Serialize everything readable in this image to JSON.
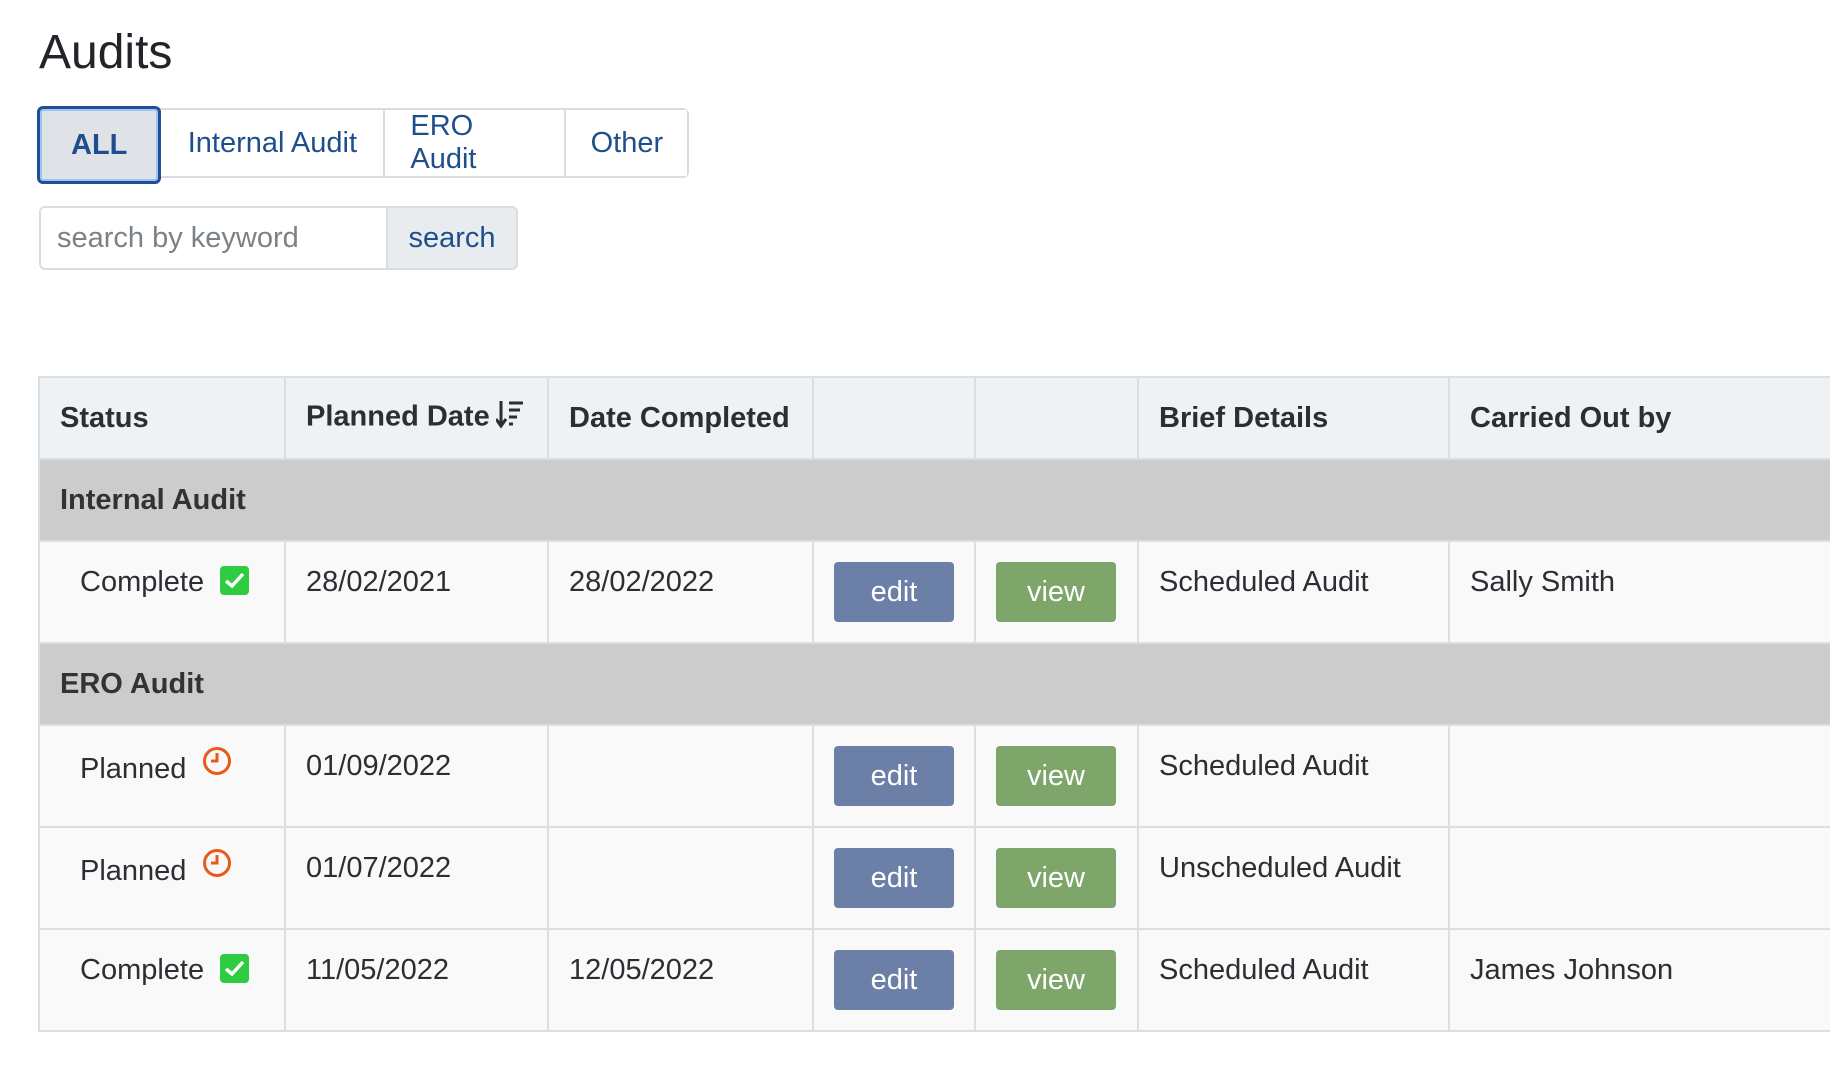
{
  "page": {
    "title": "Audits"
  },
  "filters": {
    "all": "ALL",
    "internal": "Internal Audit",
    "ero": "ERO Audit",
    "other": "Other"
  },
  "search": {
    "placeholder": "search by keyword",
    "button": "search"
  },
  "table": {
    "headers": {
      "status": "Status",
      "planned_date": "Planned Date",
      "date_completed": "Date Completed",
      "edit_col": "",
      "view_col": "",
      "brief_details": "Brief Details",
      "carried_out_by": "Carried Out by"
    },
    "groups": [
      {
        "name": "Internal Audit",
        "rows": [
          {
            "status": "Complete",
            "status_icon": "check-icon",
            "planned": "28/02/2021",
            "completed": "28/02/2022",
            "edit": "edit",
            "view": "view",
            "details": "Scheduled Audit",
            "by": "Sally Smith"
          }
        ]
      },
      {
        "name": "ERO Audit",
        "rows": [
          {
            "status": "Planned",
            "status_icon": "clock-icon",
            "planned": "01/09/2022",
            "completed": "",
            "edit": "edit",
            "view": "view",
            "details": "Scheduled Audit",
            "by": ""
          },
          {
            "status": "Planned",
            "status_icon": "clock-icon",
            "planned": "01/07/2022",
            "completed": "",
            "edit": "edit",
            "view": "view",
            "details": "Unscheduled Audit",
            "by": ""
          },
          {
            "status": "Complete",
            "status_icon": "check-icon",
            "planned": "11/05/2022",
            "completed": "12/05/2022",
            "edit": "edit",
            "view": "view",
            "details": "Scheduled Audit",
            "by": "James Johnson"
          }
        ]
      }
    ]
  },
  "colors": {
    "accent": "#1f4f94",
    "edit_button": "#6c7fa6",
    "view_button": "#7ea56a",
    "complete_icon": "#2ecc40",
    "planned_icon": "#e8591a",
    "group_row": "#cccccc"
  }
}
